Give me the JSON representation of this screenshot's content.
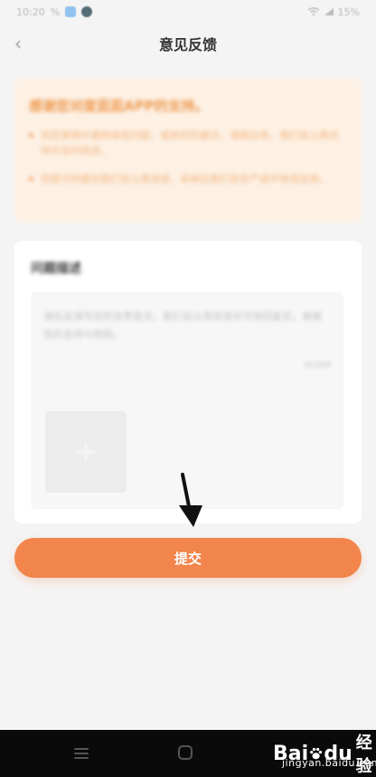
{
  "status_bar": {
    "time": "10:20",
    "signal_text": "%",
    "battery": "15%"
  },
  "header": {
    "title": "意见反馈"
  },
  "notice": {
    "heading": "感谢您对度逛逛APP的支持。",
    "items": [
      "如您使用中遇到体验问题，或有好的建议，请提出来，我们会认真对待并及时改进。",
      "您提交的建议我们会认真阅读，采纳后我们会在产品中体现出来。"
    ]
  },
  "description_card": {
    "title": "问题描述",
    "placeholder": "请在此填写您的宝贵意见，我们会认真阅读并尽快回复您，谢谢您的支持与帮助。",
    "char_count": "0/200"
  },
  "upload": {
    "plus_glyph": "+"
  },
  "submit": {
    "label": "提交"
  },
  "watermark": {
    "bai": "Bai",
    "du": "du",
    "jingyan": "经验",
    "domain": "jingyan.baidu.com"
  },
  "colors": {
    "accent": "#f2854b",
    "notice_bg": "#fdf1e4",
    "notice_text": "#ef9b52",
    "page_bg": "#f4f4f4",
    "nav_bg": "#0a0a0a"
  },
  "icons": {
    "back": "chevron-left-icon",
    "upload": "plus-icon",
    "nav_menu": "menu-icon",
    "nav_home": "home-icon"
  }
}
